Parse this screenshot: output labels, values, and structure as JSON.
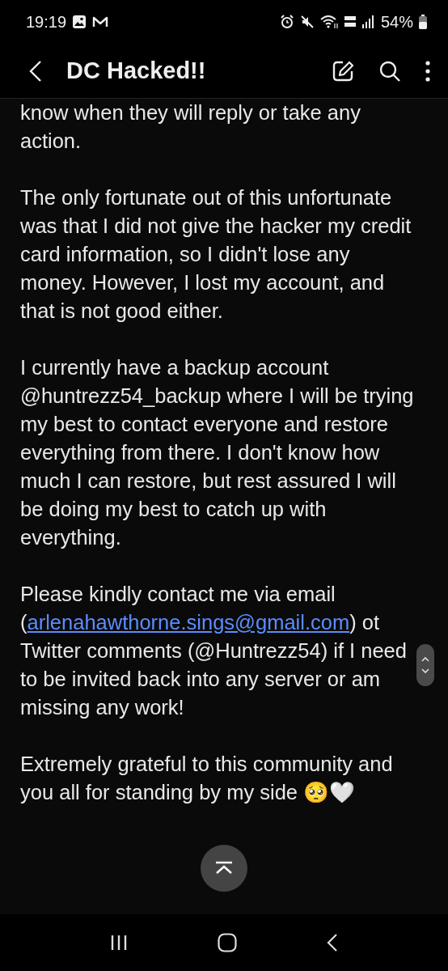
{
  "status_bar": {
    "time": "19:19",
    "battery": "54%"
  },
  "header": {
    "title": "DC Hacked!!"
  },
  "note": {
    "paragraphs": [
      {
        "lines": [
          "know when they will reply or take any",
          "action."
        ]
      },
      {
        "lines": [
          "The only fortunate out of this unfortunate",
          "was that I did not give the hacker my credit",
          "card information, so I didn't lose any",
          "money. However, I lost my account, and",
          "that is not good either."
        ]
      },
      {
        "lines": [
          "I currently have a backup account",
          "@huntrezz54_backup where I will be trying",
          "my best to contact everyone and restore",
          "everything from there. I don't know how",
          "much I can restore, but rest assured I will",
          "be doing my best to catch up with",
          "everything."
        ]
      },
      {
        "lines": [
          "Please kindly contact me via email",
          {
            "before": "(",
            "link": "arlenahawthorne.sings@gmail.com",
            "after": ") ot"
          },
          "Twitter comments (@Huntrezz54) if I need",
          "to be invited back into any server or am",
          "missing any work!"
        ]
      },
      {
        "lines": [
          "Extremely grateful to this community and",
          "you all for standing by my side 🥺🤍"
        ]
      }
    ]
  }
}
